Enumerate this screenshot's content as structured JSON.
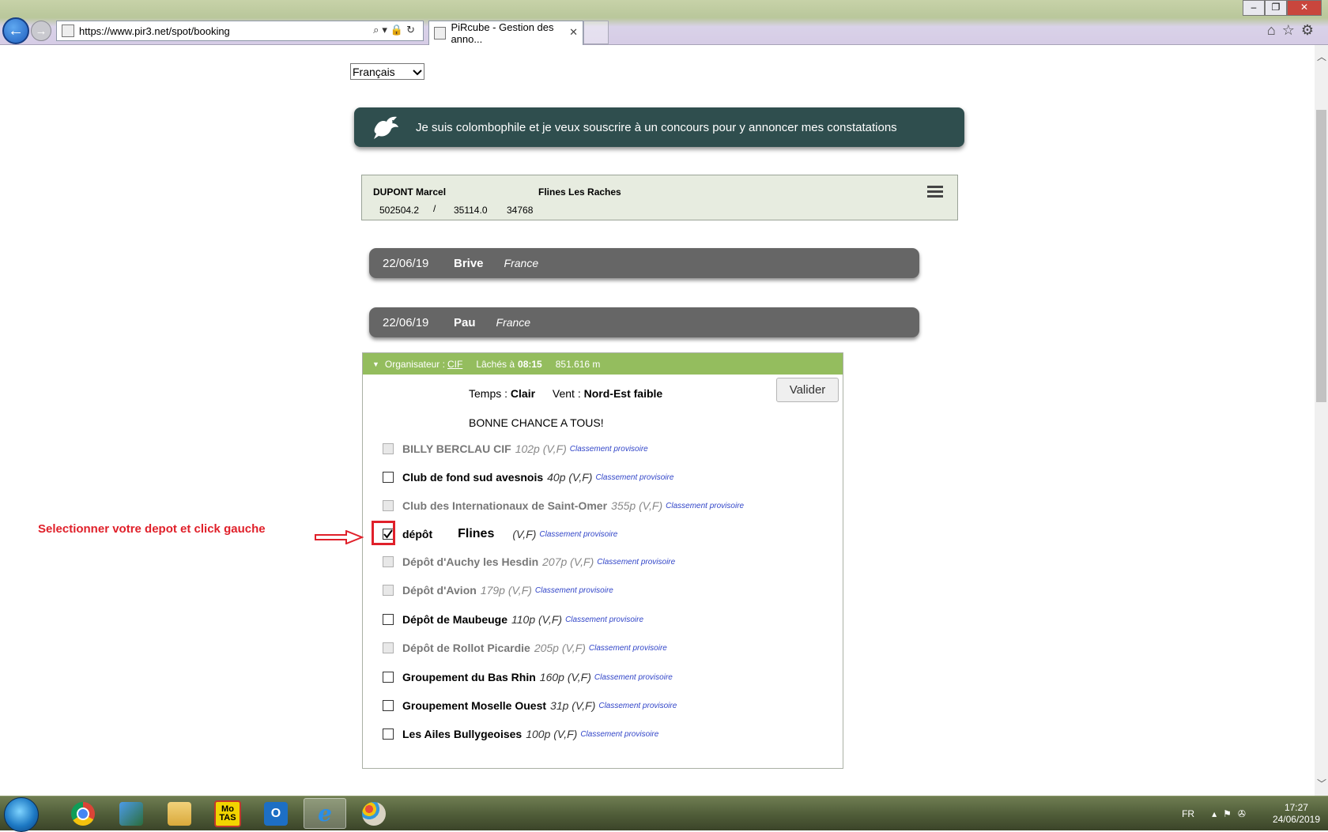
{
  "browser": {
    "url_prefix": "https://www.",
    "url_host": "pir3.net",
    "url_path": "/spot/booking",
    "tab_title": "PiRcube - Gestion des anno...",
    "tab_close": "✕"
  },
  "page": {
    "language_selected": "Français",
    "banner_text": "Je suis colombophile et je veux souscrire à un concours pour y annoncer mes constatations",
    "user": {
      "name": "DUPONT Marcel",
      "city": "Flines Les Raches",
      "coord1": "502504.2",
      "slash": "/",
      "coord2": "35114.0",
      "coord3": "34768"
    },
    "races": [
      {
        "date": "22/06/19",
        "place": "Brive",
        "country": "France"
      },
      {
        "date": "22/06/19",
        "place": "Pau",
        "country": "France"
      }
    ],
    "race_detail": {
      "organizer_label": "Organisateur :",
      "organizer": "CIF",
      "release_label": "Lâchés à",
      "release_time": "08:15",
      "distance": "851.616 m",
      "weather_label": "Temps :",
      "weather": "Clair",
      "wind_label": "Vent :",
      "wind": "Nord-Est faible",
      "message": "BONNE CHANCE A TOUS!",
      "validate_label": "Valider"
    },
    "clubs": [
      {
        "name": "BILLY BERCLAU CIF",
        "count": "102p (V,F)",
        "link": "Classement provisoire",
        "enabled": false,
        "checked": false
      },
      {
        "name": "Club de fond sud avesnois",
        "count": "40p (V,F)",
        "link": "Classement provisoire",
        "enabled": true,
        "checked": false
      },
      {
        "name": "Club des Internationaux de Saint-Omer",
        "count": "355p (V,F)",
        "link": "Classement provisoire",
        "enabled": false,
        "checked": false
      },
      {
        "name": "dépôt",
        "city": "Flines",
        "count": "(V,F)",
        "link": "Classement provisoire",
        "enabled": true,
        "checked": true
      },
      {
        "name": "Dépôt d'Auchy les Hesdin",
        "count": "207p (V,F)",
        "link": "Classement provisoire",
        "enabled": false,
        "checked": false
      },
      {
        "name": "Dépôt d'Avion",
        "count": "179p (V,F)",
        "link": "Classement provisoire",
        "enabled": false,
        "checked": false
      },
      {
        "name": "Dépôt de Maubeuge",
        "count": "110p (V,F)",
        "link": "Classement provisoire",
        "enabled": true,
        "checked": false
      },
      {
        "name": "Dépôt de Rollot Picardie",
        "count": "205p (V,F)",
        "link": "Classement provisoire",
        "enabled": false,
        "checked": false
      },
      {
        "name": "Groupement du Bas Rhin",
        "count": "160p (V,F)",
        "link": "Classement provisoire",
        "enabled": true,
        "checked": false
      },
      {
        "name": "Groupement Moselle Ouest",
        "count": "31p (V,F)",
        "link": "Classement provisoire",
        "enabled": true,
        "checked": false
      },
      {
        "name": "Les Ailes Bullygeoises",
        "count": "100p (V,F)",
        "link": "Classement provisoire",
        "enabled": true,
        "checked": false
      }
    ],
    "annotation": "Selectionner votre depot et click gauche"
  },
  "taskbar": {
    "apps": [
      "chrome-icon",
      "network-icon",
      "file-explorer-icon",
      "motas-icon",
      "outlook-icon",
      "internet-explorer-icon",
      "paint-icon"
    ],
    "motas_label_top": "Mo",
    "motas_label_bottom": "TAS",
    "language": "FR",
    "time": "17:27",
    "date": "24/06/2019"
  },
  "colors": {
    "banner_bg": "#2f4e4e",
    "race_bar_bg": "#666666",
    "detail_header_bg": "#94bd5e",
    "user_box_bg": "#e7ece0",
    "annotation": "#e0202a",
    "link": "#3145c8"
  }
}
